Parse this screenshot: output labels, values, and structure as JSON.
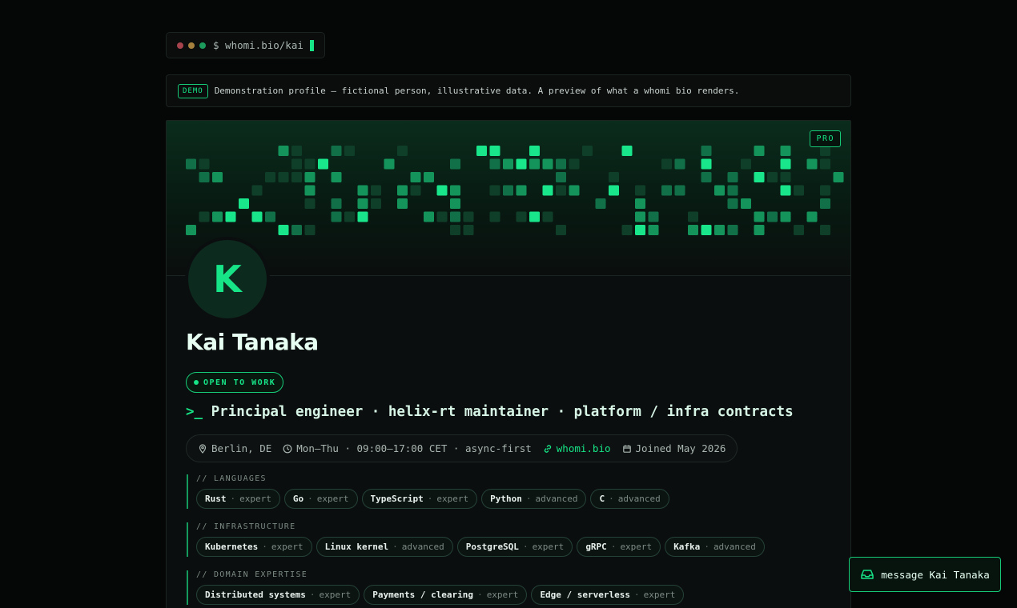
{
  "address_bar": {
    "url": "$ whomi.bio/kai"
  },
  "banner": {
    "badge": "DEMO",
    "text": "Demonstration profile — fictional person, illustrative data. A preview of what a whomi bio renders."
  },
  "profile": {
    "plan_badge": "PRO",
    "avatar_initial": "K",
    "name": "Kai Tanaka",
    "status": "OPEN TO WORK",
    "prompt": ">_",
    "headline": "Principal engineer · helix-rt maintainer · platform / infra contracts",
    "meta": {
      "location": "Berlin, DE",
      "hours": "Mon–Thu · 09:00–17:00 CET · async-first",
      "link": "whomi.bio",
      "joined": "Joined May 2026"
    }
  },
  "skill_sep": "·",
  "sections": [
    {
      "title": "// LANGUAGES",
      "skills": [
        {
          "name": "Rust",
          "level": "expert"
        },
        {
          "name": "Go",
          "level": "expert"
        },
        {
          "name": "TypeScript",
          "level": "expert"
        },
        {
          "name": "Python",
          "level": "advanced"
        },
        {
          "name": "C",
          "level": "advanced"
        }
      ]
    },
    {
      "title": "// INFRASTRUCTURE",
      "skills": [
        {
          "name": "Kubernetes",
          "level": "expert"
        },
        {
          "name": "Linux kernel",
          "level": "advanced"
        },
        {
          "name": "PostgreSQL",
          "level": "expert"
        },
        {
          "name": "gRPC",
          "level": "expert"
        },
        {
          "name": "Kafka",
          "level": "advanced"
        }
      ]
    },
    {
      "title": "// DOMAIN EXPERTISE",
      "skills": [
        {
          "name": "Distributed systems",
          "level": "expert"
        },
        {
          "name": "Payments / clearing",
          "level": "expert"
        },
        {
          "name": "Edge / serverless",
          "level": "expert"
        }
      ]
    }
  ],
  "message_button": {
    "label": "message Kai Tanaka"
  },
  "colors": {
    "accent": "#16e486",
    "background": "#050606",
    "card": "#0b0e0e"
  }
}
